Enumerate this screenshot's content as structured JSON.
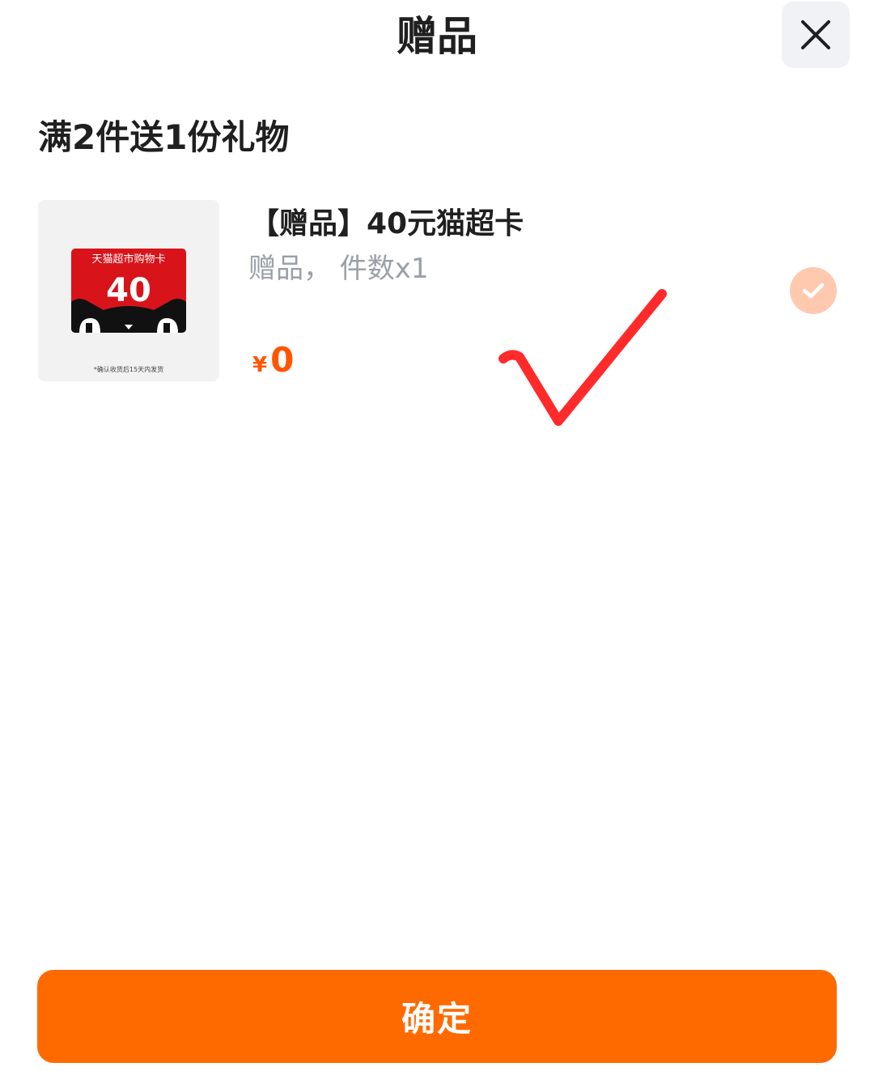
{
  "header": {
    "title": "赠品",
    "close_icon": "close-icon"
  },
  "section": {
    "title": "满2件送1份礼物"
  },
  "gift": {
    "name": "【赠品】40元猫超卡",
    "meta": "赠品， 件数x1",
    "price_symbol": "¥",
    "price": "0",
    "selected": true,
    "thumbnail": {
      "card_title": "天猫超市购物卡",
      "card_value": "40",
      "note": "*确认收货后15天内发货"
    }
  },
  "footer": {
    "confirm_label": "确定"
  },
  "colors": {
    "accent": "#ff6a00",
    "price": "#ff5500",
    "check_bg": "#ffc9b0",
    "annotation": "#ff2a2a"
  }
}
